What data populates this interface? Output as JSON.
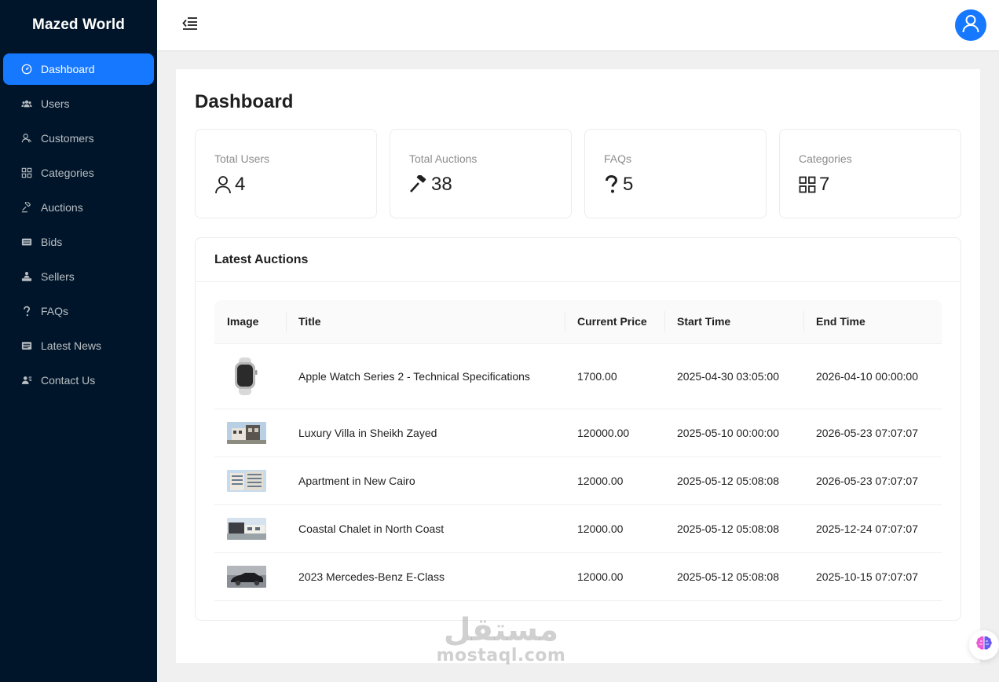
{
  "brand": {
    "name": "Mazed World"
  },
  "sidebar": {
    "items": [
      {
        "label": "Dashboard",
        "icon": "dashboard-icon",
        "active": true
      },
      {
        "label": "Users",
        "icon": "users-icon"
      },
      {
        "label": "Customers",
        "icon": "customer-icon"
      },
      {
        "label": "Categories",
        "icon": "categories-icon"
      },
      {
        "label": "Auctions",
        "icon": "gavel-icon"
      },
      {
        "label": "Bids",
        "icon": "bids-icon"
      },
      {
        "label": "Sellers",
        "icon": "sellers-icon"
      },
      {
        "label": "FAQs",
        "icon": "question-icon"
      },
      {
        "label": "Latest News",
        "icon": "news-icon"
      },
      {
        "label": "Contact Us",
        "icon": "contact-icon"
      }
    ]
  },
  "header": {
    "menu_icon": "menu-fold-icon",
    "avatar_icon": "user-icon"
  },
  "main": {
    "title": "Dashboard",
    "stats": [
      {
        "label": "Total Users",
        "value": "4",
        "icon": "user-icon"
      },
      {
        "label": "Total Auctions",
        "value": "38",
        "icon": "gavel-icon"
      },
      {
        "label": "FAQs",
        "value": "5",
        "icon": "question-icon"
      },
      {
        "label": "Categories",
        "value": "7",
        "icon": "categories-icon"
      }
    ],
    "latest_auctions": {
      "title": "Latest Auctions",
      "columns": [
        "Image",
        "Title",
        "Current Price",
        "Start Time",
        "End Time"
      ],
      "rows": [
        {
          "title": "Apple Watch Series 2 - Technical Specifications",
          "price": "1700.00",
          "start": "2025-04-30 03:05:00",
          "end": "2026-04-10 00:00:00"
        },
        {
          "title": "Luxury Villa in Sheikh Zayed",
          "price": "120000.00",
          "start": "2025-05-10 00:00:00",
          "end": "2026-05-23 07:07:07"
        },
        {
          "title": "Apartment in New Cairo",
          "price": "12000.00",
          "start": "2025-05-12 05:08:08",
          "end": "2026-05-23 07:07:07"
        },
        {
          "title": "Coastal Chalet in North Coast",
          "price": "12000.00",
          "start": "2025-05-12 05:08:08",
          "end": "2025-12-24 07:07:07"
        },
        {
          "title": "2023 Mercedes-Benz E-Class",
          "price": "12000.00",
          "start": "2025-05-12 05:08:08",
          "end": "2025-10-15 07:07:07"
        }
      ]
    }
  },
  "watermark": {
    "arabic": "مستقل",
    "latin": "mostaql.com"
  },
  "colors": {
    "sidebar_bg": "#001529",
    "accent": "#1677ff",
    "page_bg": "#f0f0f0"
  }
}
